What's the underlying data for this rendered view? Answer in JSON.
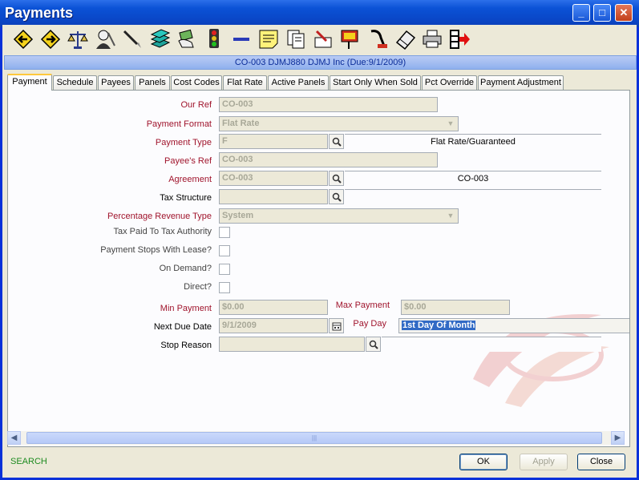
{
  "window": {
    "title": "Payments"
  },
  "context_bar": "CO-003 DJMJ880 DJMJ Inc (Due:9/1/2009)",
  "toolbar_icons": [
    "back-arrow-icon",
    "forward-arrow-icon",
    "scales-icon",
    "person-icon",
    "pen-icon",
    "stack-icon",
    "hand-money-icon",
    "traffic-light-icon",
    "minus-icon",
    "note-icon",
    "document-icon",
    "pen-paper-icon",
    "sign-icon",
    "stamp-icon",
    "eraser-icon",
    "printer-icon",
    "exit-icon"
  ],
  "tabs": [
    "Payment",
    "Schedule",
    "Payees",
    "Panels",
    "Cost Codes",
    "Flat Rate",
    "Active Panels",
    "Start Only When Sold",
    "Pct Override",
    "Payment Adjustment"
  ],
  "form": {
    "our_ref": {
      "label": "Our Ref",
      "value": "CO-003"
    },
    "payment_format": {
      "label": "Payment Format",
      "value": "Flat Rate"
    },
    "payment_type": {
      "label": "Payment Type",
      "value": "F",
      "desc": "Flat Rate/Guaranteed"
    },
    "payees_ref": {
      "label": "Payee's Ref",
      "value": "CO-003"
    },
    "agreement": {
      "label": "Agreement",
      "value": "CO-003",
      "desc": "CO-003"
    },
    "tax_structure": {
      "label": "Tax Structure",
      "value": ""
    },
    "pct_revenue_type": {
      "label": "Percentage Revenue Type",
      "value": "System"
    },
    "tax_paid": {
      "label": "Tax Paid To Tax Authority"
    },
    "payment_stops": {
      "label": "Payment Stops With Lease?"
    },
    "on_demand": {
      "label": "On Demand?"
    },
    "direct": {
      "label": "Direct?"
    },
    "min_payment": {
      "label": "Min Payment",
      "value": "$0.00"
    },
    "max_payment": {
      "label": "Max Payment",
      "value": "$0.00"
    },
    "next_due_date": {
      "label": "Next Due Date",
      "value": "9/1/2009"
    },
    "pay_day": {
      "label": "Pay Day",
      "value": "1st Day Of Month"
    },
    "stop_reason": {
      "label": "Stop Reason",
      "value": ""
    }
  },
  "status": "SEARCH",
  "buttons": {
    "ok": "OK",
    "apply": "Apply",
    "close": "Close"
  },
  "colors": {
    "required_label": "#a0142c",
    "titlebar": "#0b52d6",
    "status": "#1d8b20"
  }
}
